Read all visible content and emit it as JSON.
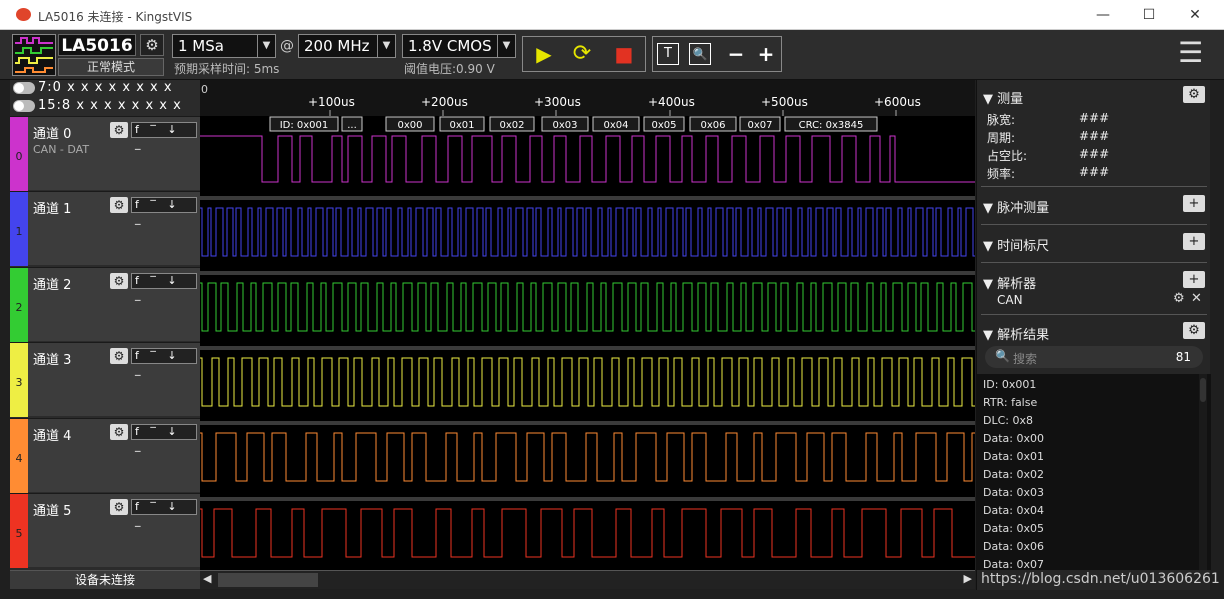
{
  "window": {
    "title": "LA5016 未连接 - KingstVIS",
    "minimize": "—",
    "maximize": "☐",
    "close": "✕"
  },
  "device": {
    "name": "LA5016",
    "mode": "正常模式",
    "gear": "⚙"
  },
  "sampling": {
    "rate": "1 MSa",
    "at": "@",
    "freq": "200 MHz",
    "expected_label": "预期采样时间: 5ms"
  },
  "threshold": {
    "value": "1.8V CMOS",
    "label": "阈值电压:0.90 V"
  },
  "buttons": {
    "run": "▶",
    "loop": "⟳",
    "stop": "■",
    "text_tool": "T",
    "zoom_fit": "🔍",
    "zoom_out": "−",
    "zoom_in": "+",
    "menu": "☰",
    "dropdown": "▼"
  },
  "bus_toggles": [
    {
      "label": "7:0",
      "bits": "x x x x x x x x"
    },
    {
      "label": "15:8",
      "bits": "x x x x x x x x"
    }
  ],
  "time_ruler": {
    "zero": "0",
    "ticks": [
      "+100us",
      "+200us",
      "+300us",
      "+400us",
      "+500us",
      "+600us"
    ]
  },
  "decode_bar": [
    "ID: 0x001",
    "...",
    "0x00",
    "0x01",
    "0x02",
    "0x03",
    "0x04",
    "0x05",
    "0x06",
    "0x07",
    "CRC: 0x3845"
  ],
  "channels": [
    {
      "num": "0",
      "name": "通道 0",
      "desc": "CAN - DAT",
      "color": "#cc33cc",
      "trig": "f ‾ ↓ _"
    },
    {
      "num": "1",
      "name": "通道 1",
      "desc": "",
      "color": "#4444ee",
      "trig": "f ‾ ↓ _"
    },
    {
      "num": "2",
      "name": "通道 2",
      "desc": "",
      "color": "#33cc33",
      "trig": "f ‾ ↓ _"
    },
    {
      "num": "3",
      "name": "通道 3",
      "desc": "",
      "color": "#eeee44",
      "trig": "f ‾ ↓ _"
    },
    {
      "num": "4",
      "name": "通道 4",
      "desc": "",
      "color": "#ff8c33",
      "trig": "f ‾ ↓ _"
    },
    {
      "num": "5",
      "name": "通道 5",
      "desc": "",
      "color": "#ee3322",
      "trig": "f ‾ ↓ _"
    }
  ],
  "channel_gear": "⚙",
  "device_status": "设备未连接",
  "panel": {
    "measure": {
      "title": "测量",
      "items": [
        {
          "k": "脉宽:",
          "v": "###"
        },
        {
          "k": "周期:",
          "v": "###"
        },
        {
          "k": "占空比:",
          "v": "###"
        },
        {
          "k": "频率:",
          "v": "###"
        }
      ]
    },
    "pulse": {
      "title": "脉冲测量"
    },
    "time_ruler": {
      "title": "时间标尺"
    },
    "analyzer": {
      "title": "解析器",
      "item": "CAN"
    },
    "results": {
      "title": "解析结果",
      "search_placeholder": "搜索",
      "count": "81",
      "lines": [
        "ID: 0x001",
        "RTR: false",
        "DLC: 0x8",
        "Data: 0x00",
        "Data: 0x01",
        "Data: 0x02",
        "Data: 0x03",
        "Data: 0x04",
        "Data: 0x05",
        "Data: 0x06",
        "Data: 0x07"
      ]
    }
  },
  "watermark": "https://blog.csdn.net/u013606261"
}
